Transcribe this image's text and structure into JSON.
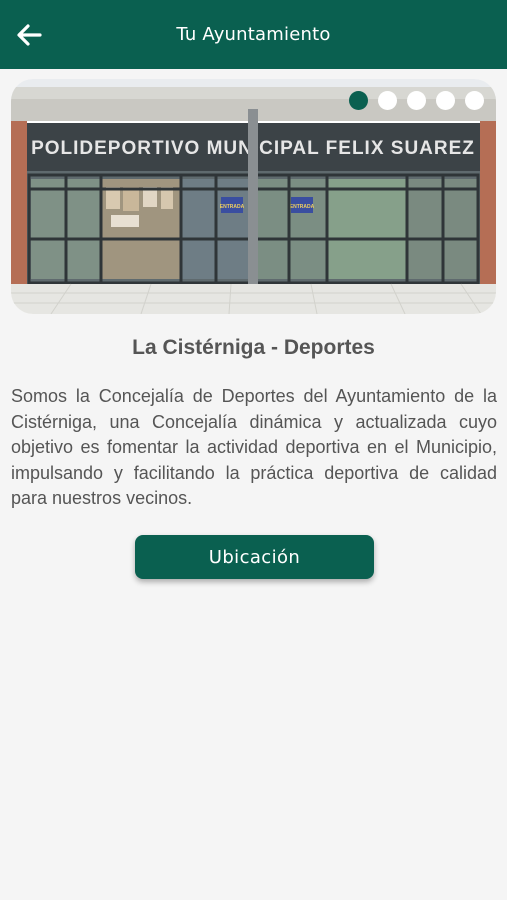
{
  "appbar": {
    "title": "Tu Ayuntamiento",
    "back_icon": "arrow-left-icon",
    "color": "#0a6050"
  },
  "carousel": {
    "photo_sign_text": "POLIDEPORTIVO MUNICIPAL FELIX SUAREZ",
    "door_sign_text": "ENTRADA",
    "slide_count": 5,
    "active_index": 0
  },
  "content": {
    "heading": "La Cistérniga - Deportes",
    "description": "Somos la Concejalía de Deportes del Ayuntamiento de la Cistérniga, una Concejalía dinámica y actualizada cuyo objetivo es fomentar la actividad deportiva en el Municipio, impulsando y facilitando la práctica deportiva de calidad para nuestros vecinos."
  },
  "actions": {
    "location_label": "Ubicación"
  }
}
